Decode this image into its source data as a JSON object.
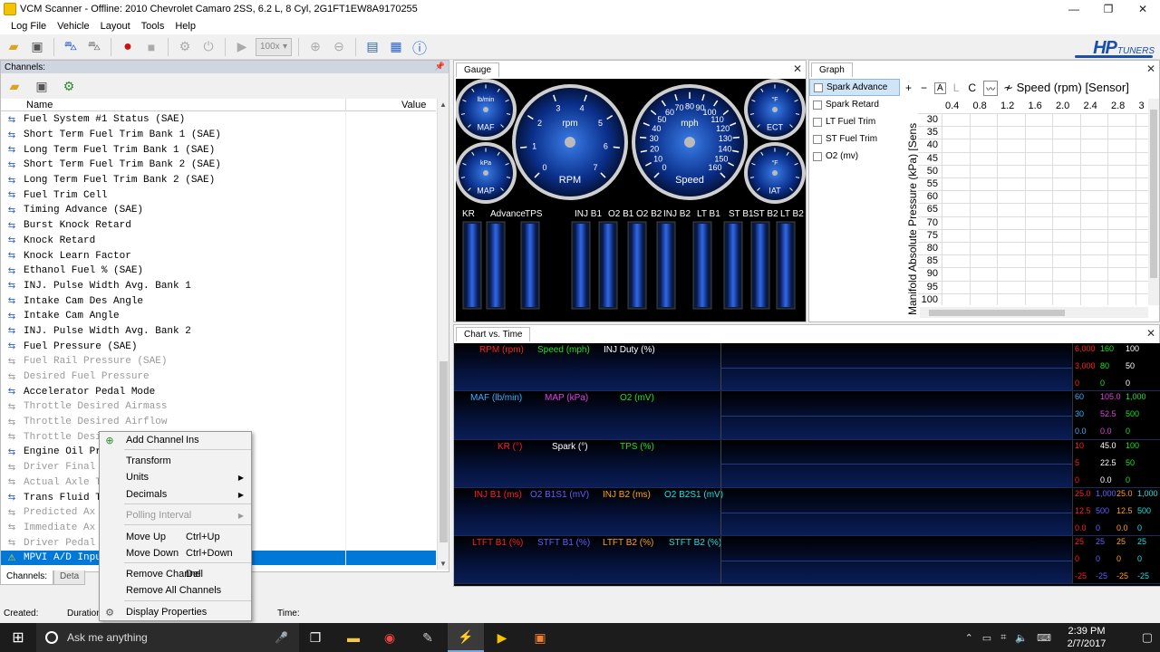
{
  "window": {
    "title": "VCM Scanner - Offline: 2010 Chevrolet Camaro 2SS, 6.2 L, 8 Cyl, 2G1FT1EW8A9170255",
    "controls": [
      "—",
      "❐",
      "✕"
    ]
  },
  "menu": [
    "Log File",
    "Vehicle",
    "Layout",
    "Tools",
    "Help"
  ],
  "toolbar": {
    "zoom": "100x"
  },
  "logo": {
    "hp": "HP",
    "tuners": "TUNERS"
  },
  "channels": {
    "title": "Channels:",
    "col_name": "Name",
    "col_value": "Value",
    "items": [
      {
        "name": "Fuel System #1 Status (SAE)",
        "state": "enabled"
      },
      {
        "name": "Short Term Fuel Trim Bank 1 (SAE)",
        "state": "enabled"
      },
      {
        "name": "Long Term Fuel Trim Bank 1 (SAE)",
        "state": "enabled"
      },
      {
        "name": "Short Term Fuel Trim Bank 2 (SAE)",
        "state": "enabled"
      },
      {
        "name": "Long Term Fuel Trim Bank 2 (SAE)",
        "state": "enabled"
      },
      {
        "name": "Fuel Trim Cell",
        "state": "enabled"
      },
      {
        "name": "Timing Advance (SAE)",
        "state": "enabled"
      },
      {
        "name": "Burst Knock Retard",
        "state": "enabled"
      },
      {
        "name": "Knock Retard",
        "state": "enabled"
      },
      {
        "name": "Knock Learn Factor",
        "state": "enabled"
      },
      {
        "name": "Ethanol Fuel % (SAE)",
        "state": "enabled"
      },
      {
        "name": "INJ. Pulse Width Avg. Bank 1",
        "state": "enabled"
      },
      {
        "name": "Intake Cam Des Angle",
        "state": "enabled"
      },
      {
        "name": "Intake Cam Angle",
        "state": "enabled"
      },
      {
        "name": "INJ. Pulse Width Avg. Bank 2",
        "state": "enabled"
      },
      {
        "name": "Fuel Pressure (SAE)",
        "state": "enabled"
      },
      {
        "name": "Fuel Rail Pressure (SAE)",
        "state": "disabled"
      },
      {
        "name": "Desired Fuel Pressure",
        "state": "disabled"
      },
      {
        "name": "Accelerator Pedal Mode",
        "state": "enabled"
      },
      {
        "name": "Throttle Desired Airmass",
        "state": "disabled"
      },
      {
        "name": "Throttle Desired Airflow",
        "state": "disabled"
      },
      {
        "name": "Throttle Desi",
        "state": "disabled"
      },
      {
        "name": "Engine Oil Pr",
        "state": "enabled"
      },
      {
        "name": "Driver Final",
        "state": "disabled"
      },
      {
        "name": "Actual Axle T",
        "state": "disabled"
      },
      {
        "name": "Trans Fluid T",
        "state": "enabled"
      },
      {
        "name": "Predicted Ax",
        "state": "disabled"
      },
      {
        "name": "Immediate Ax",
        "state": "disabled"
      },
      {
        "name": "Driver Pedal",
        "state": "disabled"
      },
      {
        "name": "MPVI A/D Inpu",
        "state": "selected"
      }
    ],
    "tabs": [
      "Channels:",
      "Deta"
    ]
  },
  "status": {
    "created": "Created:",
    "duration": "Duration",
    "time": "Time:"
  },
  "gauge": {
    "tab": "Gauge",
    "big": [
      {
        "label": "RPM",
        "unit": "rpm",
        "ticks": [
          "0",
          "1",
          "2",
          "3",
          "4",
          "5",
          "6",
          "7"
        ]
      },
      {
        "label": "Speed",
        "unit": "mph",
        "ticks": [
          "0",
          "10",
          "20",
          "30",
          "40",
          "50",
          "60",
          "70",
          "80",
          "90",
          "100",
          "110",
          "120",
          "130",
          "140",
          "150",
          "160"
        ]
      }
    ],
    "small": [
      {
        "label": "MAF",
        "unit": "lb/min"
      },
      {
        "label": "MAP",
        "unit": "kPa"
      },
      {
        "label": "ECT",
        "unit": "°F"
      },
      {
        "label": "IAT",
        "unit": "°F"
      }
    ],
    "bar_labels": [
      "KR",
      "Advance",
      "TPS",
      "INJ B1",
      "O2 B1",
      "O2 B2",
      "INJ B2",
      "LT B1",
      "ST B1",
      "ST B2",
      "LT B2"
    ]
  },
  "graph": {
    "tab": "Graph",
    "tables": [
      "Spark Advance",
      "Spark Retard",
      "LT Fuel Trim",
      "ST Fuel Trim",
      "O2 (mv)"
    ],
    "toolbar": {
      "plus": "+",
      "minus": "−",
      "a": "A",
      "l": "L",
      "c": "C",
      "title": "Speed (rpm) [Sensor]"
    },
    "ylabel": "Manifold Absolute Pressure (kPa) [Sens",
    "x_values": [
      "0.4",
      "0.8",
      "1.2",
      "1.6",
      "2.0",
      "2.4",
      "2.8",
      "3"
    ],
    "y_values": [
      "30",
      "35",
      "40",
      "45",
      "50",
      "55",
      "60",
      "65",
      "70",
      "75",
      "80",
      "85",
      "90",
      "95",
      "100"
    ]
  },
  "chart": {
    "tab": "Chart vs. Time",
    "strips": [
      {
        "labels": [
          {
            "t": "RPM (rpm)",
            "c": "#ff2020"
          },
          {
            "t": "Speed (mph)",
            "c": "#20e020"
          },
          {
            "t": "INJ Duty (%)",
            "c": "#ffffff"
          }
        ],
        "scale": [
          [
            {
              "t": "6,000",
              "c": "#ff2020"
            },
            {
              "t": "160",
              "c": "#20e020"
            },
            {
              "t": "100",
              "c": "#ffffff"
            }
          ],
          [
            {
              "t": "3,000",
              "c": "#ff2020"
            },
            {
              "t": "80",
              "c": "#20e020"
            },
            {
              "t": "50",
              "c": "#ffffff"
            }
          ],
          [
            {
              "t": "0",
              "c": "#ff2020"
            },
            {
              "t": "0",
              "c": "#20e020"
            },
            {
              "t": "0",
              "c": "#ffffff"
            }
          ]
        ]
      },
      {
        "labels": [
          {
            "t": "MAF (lb/min)",
            "c": "#3ab0ff"
          },
          {
            "t": "MAP (kPa)",
            "c": "#e040e0"
          },
          {
            "t": "O2 (mV)",
            "c": "#20e020"
          }
        ],
        "scale": [
          [
            {
              "t": "60",
              "c": "#3ab0ff"
            },
            {
              "t": "105.0",
              "c": "#e040e0"
            },
            {
              "t": "1,000",
              "c": "#20e020"
            }
          ],
          [
            {
              "t": "30",
              "c": "#3ab0ff"
            },
            {
              "t": "52.5",
              "c": "#e040e0"
            },
            {
              "t": "500",
              "c": "#20e020"
            }
          ],
          [
            {
              "t": "0.0",
              "c": "#3ab0ff"
            },
            {
              "t": "0.0",
              "c": "#e040e0"
            },
            {
              "t": "0",
              "c": "#20e020"
            }
          ]
        ]
      },
      {
        "labels": [
          {
            "t": "KR (°)",
            "c": "#ff2020"
          },
          {
            "t": "Spark (°)",
            "c": "#ffffff"
          },
          {
            "t": "TPS (%)",
            "c": "#20e020"
          }
        ],
        "scale": [
          [
            {
              "t": "10",
              "c": "#ff2020"
            },
            {
              "t": "45.0",
              "c": "#ffffff"
            },
            {
              "t": "100",
              "c": "#20e020"
            }
          ],
          [
            {
              "t": "5",
              "c": "#ff2020"
            },
            {
              "t": "22.5",
              "c": "#ffffff"
            },
            {
              "t": "50",
              "c": "#20e020"
            }
          ],
          [
            {
              "t": "0",
              "c": "#ff2020"
            },
            {
              "t": "0.0",
              "c": "#ffffff"
            },
            {
              "t": "0",
              "c": "#20e020"
            }
          ]
        ]
      },
      {
        "labels": [
          {
            "t": "INJ B1 (ms)",
            "c": "#ff2020"
          },
          {
            "t": "O2 B1S1 (mV)",
            "c": "#6060ff"
          },
          {
            "t": "INJ B2 (ms)",
            "c": "#ffa020"
          },
          {
            "t": "O2 B2S1 (mV)",
            "c": "#20e0e0"
          }
        ],
        "scale": [
          [
            {
              "t": "25.0",
              "c": "#ff2020"
            },
            {
              "t": "1,000",
              "c": "#6060ff"
            },
            {
              "t": "25.0",
              "c": "#ffa020"
            },
            {
              "t": "1,000",
              "c": "#20e0e0"
            }
          ],
          [
            {
              "t": "12.5",
              "c": "#ff2020"
            },
            {
              "t": "500",
              "c": "#6060ff"
            },
            {
              "t": "12.5",
              "c": "#ffa020"
            },
            {
              "t": "500",
              "c": "#20e0e0"
            }
          ],
          [
            {
              "t": "0.0",
              "c": "#ff2020"
            },
            {
              "t": "0",
              "c": "#6060ff"
            },
            {
              "t": "0.0",
              "c": "#ffa020"
            },
            {
              "t": "0",
              "c": "#20e0e0"
            }
          ]
        ]
      },
      {
        "labels": [
          {
            "t": "LTFT B1 (%)",
            "c": "#ff2020"
          },
          {
            "t": "STFT B1 (%)",
            "c": "#6060ff"
          },
          {
            "t": "LTFT B2 (%)",
            "c": "#ffa020"
          },
          {
            "t": "STFT B2 (%)",
            "c": "#20e0e0"
          }
        ],
        "scale": [
          [
            {
              "t": "25",
              "c": "#ff2020"
            },
            {
              "t": "25",
              "c": "#6060ff"
            },
            {
              "t": "25",
              "c": "#ffa020"
            },
            {
              "t": "25",
              "c": "#20e0e0"
            }
          ],
          [
            {
              "t": "0",
              "c": "#ff2020"
            },
            {
              "t": "0",
              "c": "#6060ff"
            },
            {
              "t": "0",
              "c": "#ffa020"
            },
            {
              "t": "0",
              "c": "#20e0e0"
            }
          ],
          [
            {
              "t": "-25",
              "c": "#ff2020"
            },
            {
              "t": "-25",
              "c": "#6060ff"
            },
            {
              "t": "-25",
              "c": "#ffa020"
            },
            {
              "t": "-25",
              "c": "#20e0e0"
            }
          ]
        ]
      }
    ]
  },
  "context_menu": {
    "items": [
      {
        "label": "Add Channel",
        "shortcut": "Ins",
        "icon": "add-icon"
      },
      {
        "label": "Transform"
      },
      {
        "label": "Units",
        "submenu": true
      },
      {
        "label": "Decimals",
        "submenu": true
      },
      {
        "label": "Polling Interval",
        "submenu": true,
        "disabled": true
      },
      {
        "label": "Move Up",
        "shortcut": "Ctrl+Up"
      },
      {
        "label": "Move Down",
        "shortcut": "Ctrl+Down"
      },
      {
        "label": "Remove Channel",
        "shortcut": "Del"
      },
      {
        "label": "Remove All Channels"
      },
      {
        "label": "Display Properties",
        "icon": "gear-icon"
      }
    ]
  },
  "taskbar": {
    "search_placeholder": "Ask me anything",
    "time": "2:39 PM",
    "date": "2/7/2017"
  }
}
